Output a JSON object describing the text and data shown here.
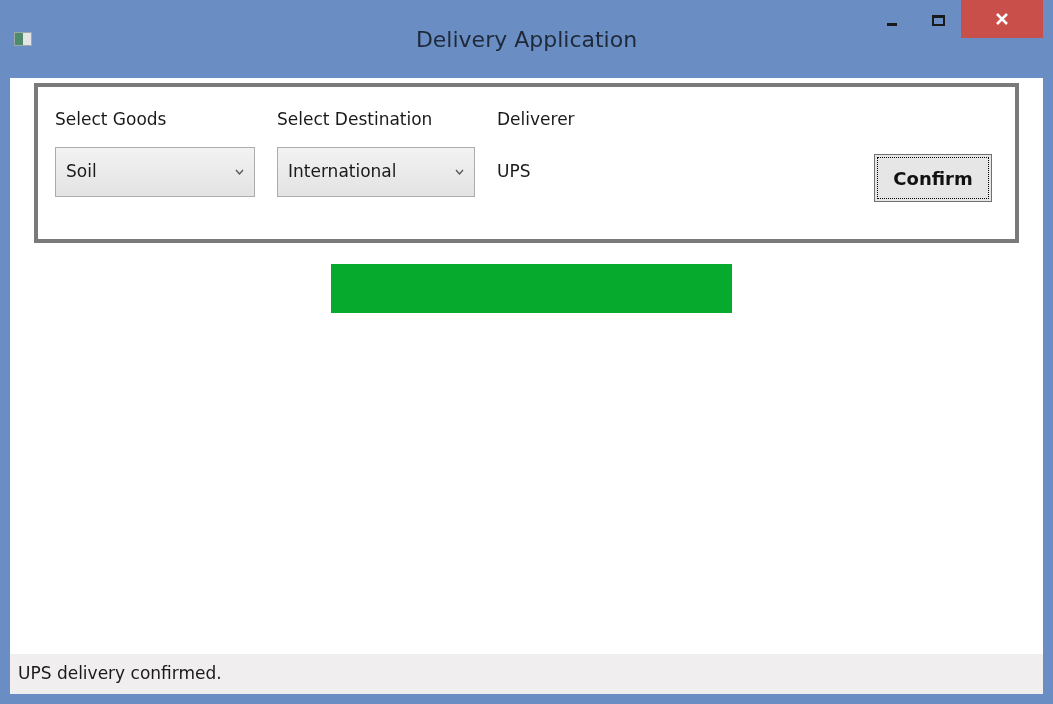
{
  "window": {
    "title": "Delivery Application"
  },
  "form": {
    "fields": [
      {
        "kind": "dropdown",
        "label": "Select Goods",
        "value": "Soil"
      },
      {
        "kind": "dropdown",
        "label": "Select Destination",
        "value": "International"
      },
      {
        "kind": "text",
        "label": "Deliverer",
        "value": "UPS"
      }
    ],
    "confirm_button": {
      "label": "Confirm",
      "focused": true
    }
  },
  "indicator": {
    "on": true
  },
  "status_bar": {
    "text": "UPS delivery confirmed."
  }
}
